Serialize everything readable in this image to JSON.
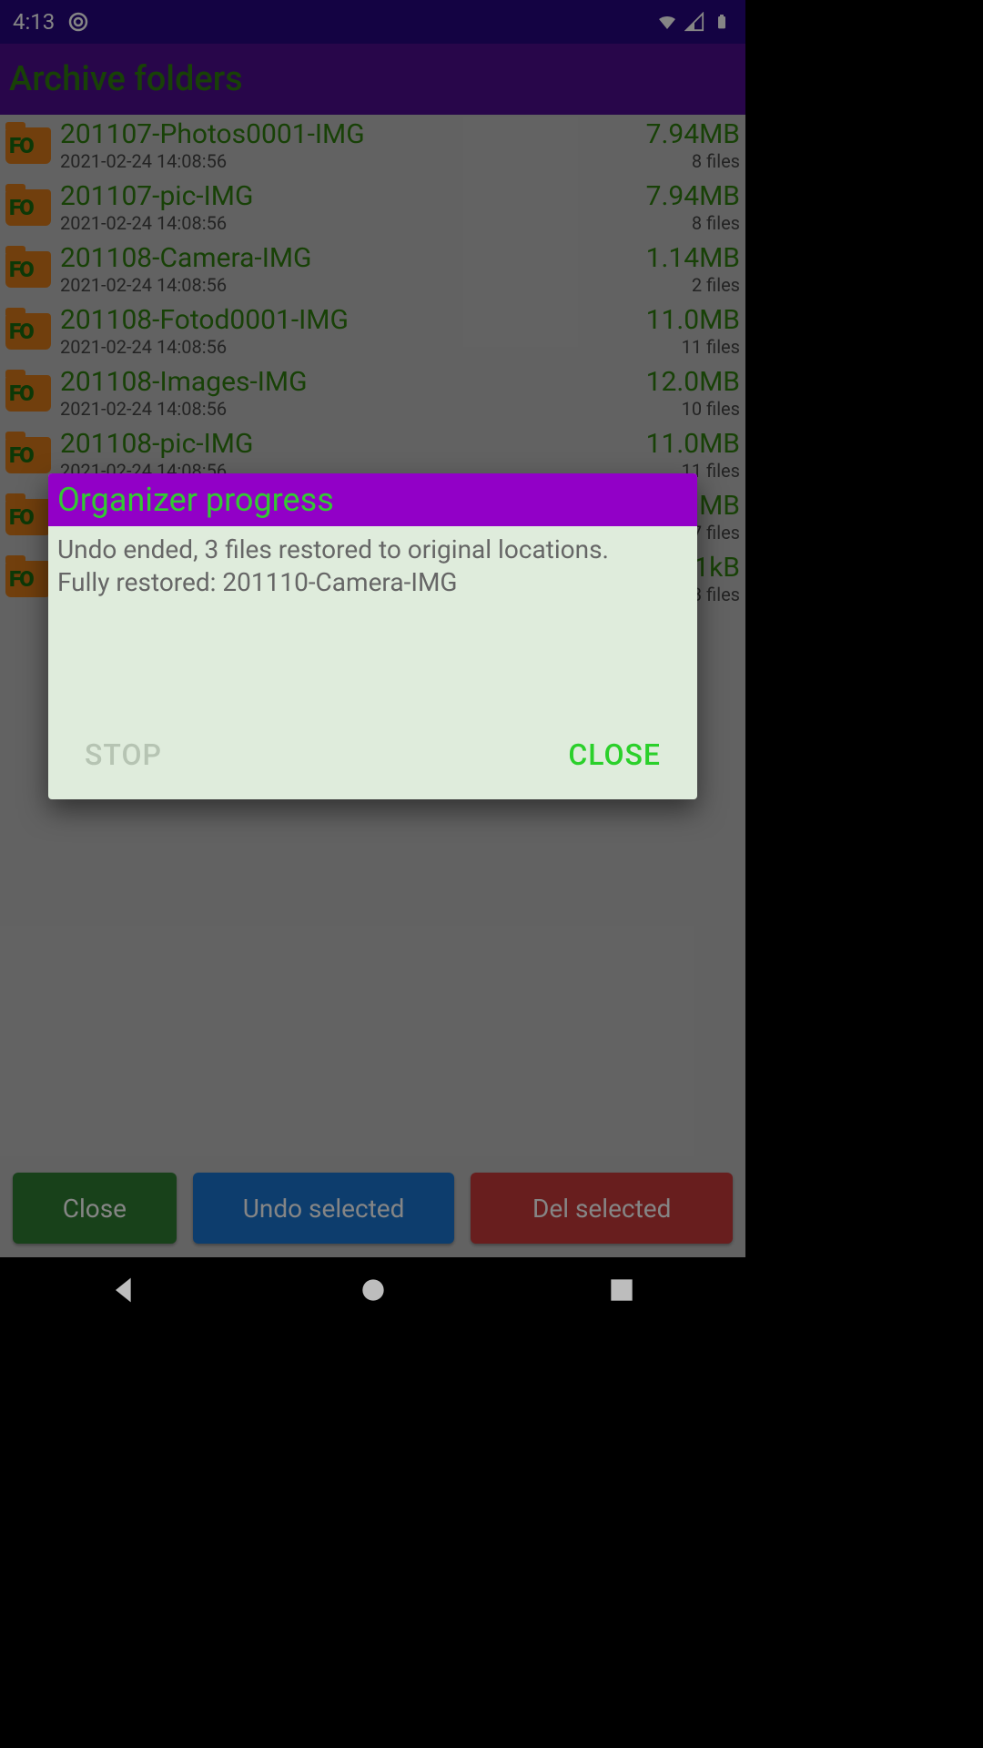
{
  "status": {
    "time": "4:13"
  },
  "app": {
    "title": "Archive folders"
  },
  "folders": [
    {
      "name": "201107-Photos0001-IMG",
      "date": "2021-02-24 14:08:56",
      "size": "7.94MB",
      "count": "8 files"
    },
    {
      "name": "201107-pic-IMG",
      "date": "2021-02-24 14:08:56",
      "size": "7.94MB",
      "count": "8 files"
    },
    {
      "name": "201108-Camera-IMG",
      "date": "2021-02-24 14:08:56",
      "size": "1.14MB",
      "count": "2 files"
    },
    {
      "name": "201108-Fotod0001-IMG",
      "date": "2021-02-24 14:08:56",
      "size": "11.0MB",
      "count": "11 files"
    },
    {
      "name": "201108-Images-IMG",
      "date": "2021-02-24 14:08:56",
      "size": "12.0MB",
      "count": "10 files"
    },
    {
      "name": "201108-pic-IMG",
      "date": "2021-02-24 14:08:56",
      "size": "11.0MB",
      "count": "11 files"
    },
    {
      "name": "",
      "date": "",
      "size": "MB",
      "count": "7 files"
    },
    {
      "name": "",
      "date": "",
      "size": "1kB",
      "count": "3 files"
    }
  ],
  "buttons": {
    "close": "Close",
    "undo": "Undo selected",
    "del": "Del selected"
  },
  "dialog": {
    "title": "Organizer progress",
    "line1": "Undo ended, 3 files restored to original locations.",
    "line2": "Fully restored: 201110-Camera-IMG",
    "stop": "STOP",
    "close": "CLOSE"
  }
}
